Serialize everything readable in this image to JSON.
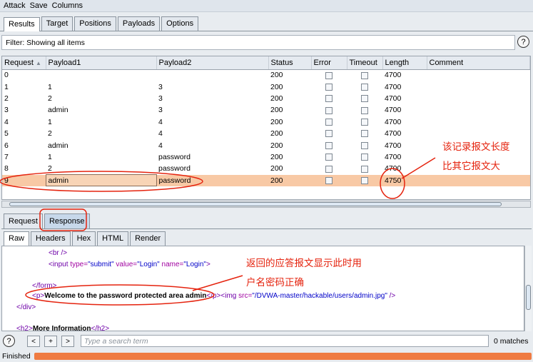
{
  "menubar": {
    "items": [
      "Attack",
      "Save",
      "Columns"
    ]
  },
  "top_tabs": [
    {
      "label": "Results",
      "active": true
    },
    {
      "label": "Target",
      "active": false
    },
    {
      "label": "Positions",
      "active": false
    },
    {
      "label": "Payloads",
      "active": false
    },
    {
      "label": "Options",
      "active": false
    }
  ],
  "filter": {
    "text": "Filter: Showing all items"
  },
  "help_symbol": "?",
  "table": {
    "columns": [
      "Request",
      "Payload1",
      "Payload2",
      "Status",
      "Error",
      "Timeout",
      "Length",
      "Comment"
    ],
    "sort_indicator": "▲",
    "rows": [
      {
        "request": "0",
        "payload1": "",
        "payload2": "",
        "status": "200",
        "length": "4700"
      },
      {
        "request": "1",
        "payload1": "1",
        "payload2": "3",
        "status": "200",
        "length": "4700"
      },
      {
        "request": "2",
        "payload1": "2",
        "payload2": "3",
        "status": "200",
        "length": "4700"
      },
      {
        "request": "3",
        "payload1": "admin",
        "payload2": "3",
        "status": "200",
        "length": "4700"
      },
      {
        "request": "4",
        "payload1": "1",
        "payload2": "4",
        "status": "200",
        "length": "4700"
      },
      {
        "request": "5",
        "payload1": "2",
        "payload2": "4",
        "status": "200",
        "length": "4700"
      },
      {
        "request": "6",
        "payload1": "admin",
        "payload2": "4",
        "status": "200",
        "length": "4700"
      },
      {
        "request": "7",
        "payload1": "1",
        "payload2": "password",
        "status": "200",
        "length": "4700"
      },
      {
        "request": "8",
        "payload1": "2",
        "payload2": "password",
        "status": "200",
        "length": "4700"
      },
      {
        "request": "9",
        "payload1": "admin",
        "payload2": "password",
        "status": "200",
        "length": "4750",
        "selected": true
      }
    ]
  },
  "message_tabs": [
    {
      "label": "Request",
      "active": false
    },
    {
      "label": "Response",
      "active": true
    }
  ],
  "view_tabs": [
    {
      "label": "Raw",
      "active": true
    },
    {
      "label": "Headers",
      "active": false
    },
    {
      "label": "Hex",
      "active": false
    },
    {
      "label": "HTML",
      "active": false
    },
    {
      "label": "Render",
      "active": false
    }
  ],
  "code": {
    "line1": "<br />",
    "line2": {
      "open": "<input ",
      "a1": "type=",
      "v1": "\"submit\"",
      "a2": " value=",
      "v2": "\"Login\"",
      "a3": " name=",
      "v3": "\"Login\"",
      "close": ">"
    },
    "line3": "</form>",
    "line4": {
      "p_open": "<p>",
      "text": "Welcome to the password protected area admin",
      "p_close": "</p>",
      "img_open": "<img ",
      "src_attr": "src=",
      "src_val": "\"/DVWA-master/hackable/users/admin.jpg\"",
      "img_close": " />"
    },
    "line5": "</div>",
    "line6": {
      "open": "<h2>",
      "text": "More Information",
      "close": "</h2>"
    }
  },
  "search": {
    "help": "?",
    "prev": "<",
    "add": "+",
    "next": ">",
    "placeholder": "Type a search term",
    "matches": "0 matches"
  },
  "status": {
    "text": "Finished",
    "progress_fraction": 1.0
  },
  "annotations": {
    "length_note_line1": "该记录报文长度",
    "length_note_line2": "比其它报文大",
    "response_note_line1": "返回的应答报文显示此时用",
    "response_note_line2": "户名密码正确"
  },
  "colors": {
    "selected_row": "#f8c9a5",
    "annotation": "#e5230e",
    "progress": "#ef7b42"
  }
}
